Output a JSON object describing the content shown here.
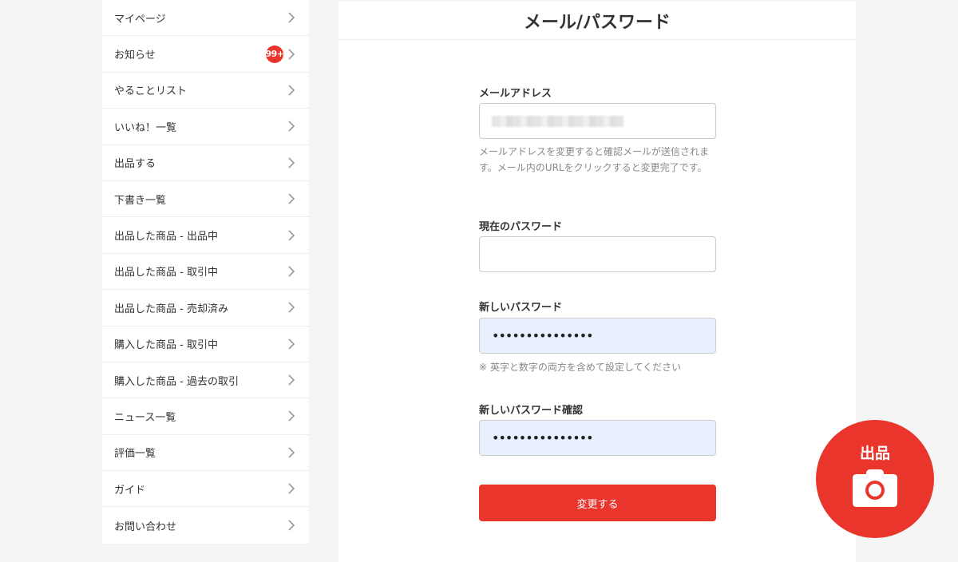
{
  "sidebar": {
    "items": [
      {
        "label": "マイページ"
      },
      {
        "label": "お知らせ",
        "badge": "99+"
      },
      {
        "label": "やることリスト"
      },
      {
        "label": "いいね！一覧"
      },
      {
        "label": "出品する"
      },
      {
        "label": "下書き一覧"
      },
      {
        "label": "出品した商品 - 出品中"
      },
      {
        "label": "出品した商品 - 取引中"
      },
      {
        "label": "出品した商品 - 売却済み"
      },
      {
        "label": "購入した商品 - 取引中"
      },
      {
        "label": "購入した商品 - 過去の取引"
      },
      {
        "label": "ニュース一覧"
      },
      {
        "label": "評価一覧"
      },
      {
        "label": "ガイド"
      },
      {
        "label": "お問い合わせ"
      }
    ],
    "chevron_icon": "chevron-right-icon"
  },
  "main": {
    "title": "メール/パスワード",
    "email": {
      "label": "メールアドレス",
      "value_state": "blurred",
      "help": "メールアドレスを変更すると確認メールが送信されます。メール内のURLをクリックすると変更完了です。"
    },
    "current_password": {
      "label": "現在のパスワード",
      "value": ""
    },
    "new_password": {
      "label": "新しいパスワード",
      "value": "•••••••••••••••",
      "help": "※ 英字と数字の両方を含めて設定してください"
    },
    "confirm_password": {
      "label": "新しいパスワード確認",
      "value": "•••••••••••••••"
    },
    "submit_label": "変更する"
  },
  "fab": {
    "label": "出品",
    "icon": "camera-icon"
  },
  "colors": {
    "accent": "#ea352d",
    "background": "#f5f5f5",
    "autofill": "#e8f0fe"
  }
}
